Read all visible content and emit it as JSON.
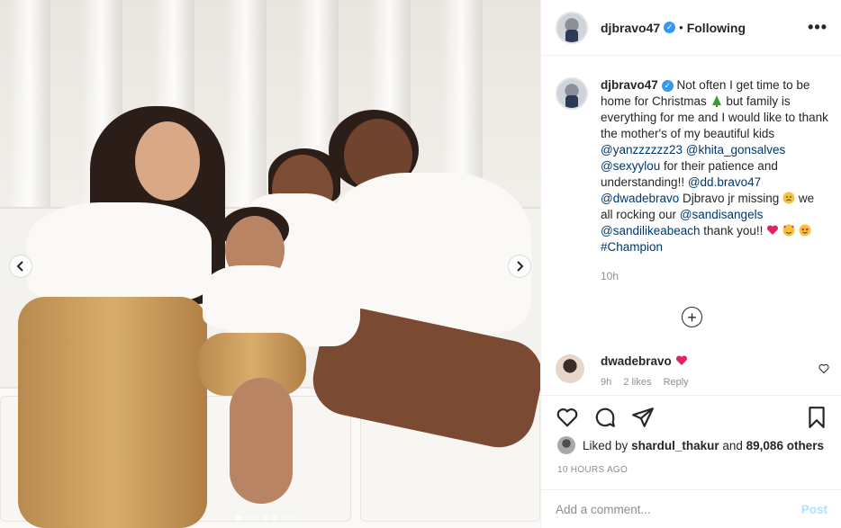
{
  "post": {
    "username": "djbravo47",
    "verified_mark": "✓",
    "bullet": "•",
    "follow_status": "Following",
    "more_label": "•••",
    "caption": {
      "username": "djbravo47",
      "t1": "Not often I get time to be home for Christmas",
      "t2": "but family is everything for me and I would like to thank the mother's of my beautiful kids",
      "m1": "@yanzzzzzz23",
      "m2": "@khita_gonsalves",
      "m3": "@sexyylou",
      "t3": "for their patience and understanding!!",
      "m4": "@dd.bravo47",
      "m5": "@dwadebravo",
      "t4": "Djbravo jr missing",
      "t5": "we all rocking our",
      "m6": "@sandisangels",
      "m7": "@sandilikeabeach",
      "t6": "thank you!!",
      "m8": "#Champion",
      "time": "10h"
    },
    "load_more": "+",
    "comment": {
      "username": "dwadebravo",
      "time": "9h",
      "likes": "2 likes",
      "reply": "Reply"
    },
    "likes": {
      "prefix": "Liked by",
      "user": "shardul_thakur",
      "middle": "and",
      "count": "89,086 others"
    },
    "posted": "10 HOURS AGO",
    "add_comment": {
      "placeholder": "Add a comment...",
      "post_label": "Post"
    }
  },
  "carousel": {
    "total_slides": 7,
    "active_slide": 1
  },
  "colors": {
    "verified": "#3897f0",
    "mention": "#00376b",
    "post_disabled": "#b2dffc",
    "heart": "#ed4956"
  },
  "icons": [
    "chevron-left-icon",
    "chevron-right-icon",
    "heart-icon",
    "comment-icon",
    "share-icon",
    "bookmark-icon",
    "plus-circle-icon"
  ]
}
